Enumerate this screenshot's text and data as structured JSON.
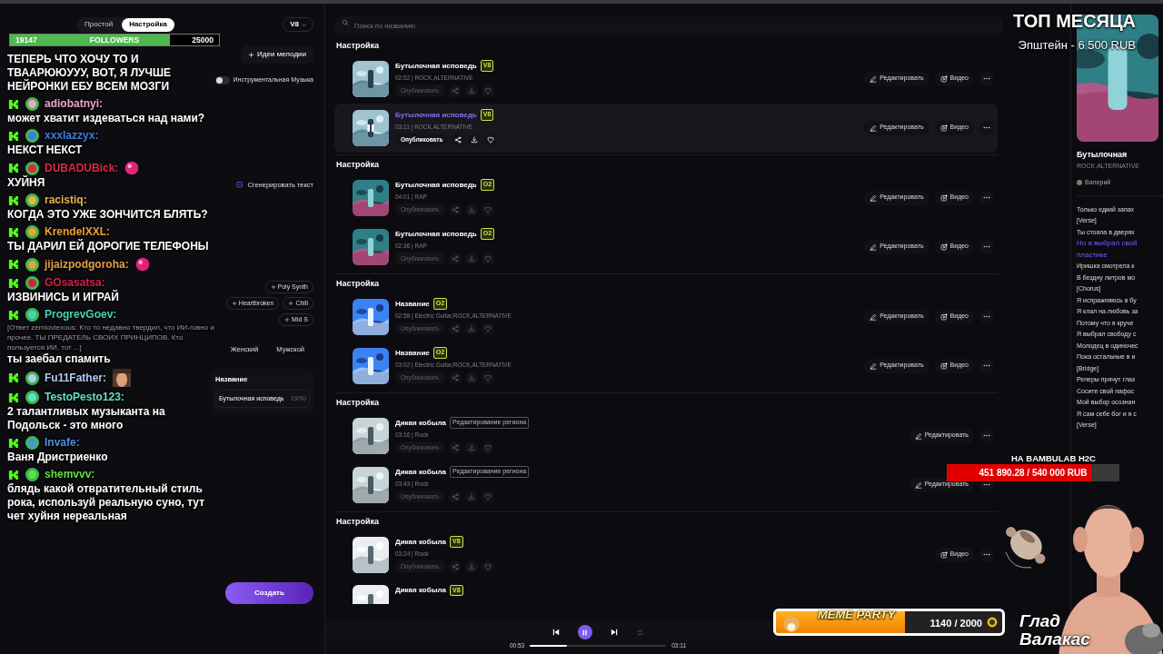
{
  "left_panel": {
    "tabs": [
      {
        "label": "Простой",
        "selected": false
      },
      {
        "label": "Настройка",
        "selected": true
      }
    ],
    "model": "V8",
    "melody_button": "Идеи мелодии",
    "instrumental": {
      "label": "Инструментальная Музыка",
      "on": false
    },
    "generate_lyrics": "Сгенерировать текст",
    "style_tags": [
      "Poly Synth",
      "Heartbroken",
      "Chill",
      "Mid S"
    ],
    "voice_options": [
      {
        "label": "Женский",
        "selected": false
      },
      {
        "label": "Мужской",
        "selected": false
      }
    ],
    "title_field": {
      "label": "Название",
      "value": "Бутылочная исповедь",
      "counter": "19/50"
    },
    "create_button": "Создать"
  },
  "search": {
    "placeholder": "Поиск по названию"
  },
  "groups": [
    {
      "heading": "Настройка",
      "tracks": [
        {
          "title": "Бутылочная исповедь",
          "badge": {
            "kind": "version",
            "label": "V8"
          },
          "meta": "02:52 | ROCK,ALTERNATIVE",
          "publish": "Опубликовать",
          "selected": false,
          "actions": [
            {
              "kind": "edit",
              "label": "Редактировать"
            },
            {
              "kind": "video",
              "label": "Видео"
            },
            {
              "kind": "more"
            }
          ]
        },
        {
          "title": "Бутылочная исповедь",
          "badge": {
            "kind": "version",
            "label": "V8"
          },
          "meta": "03:11 | ROCK,ALTERNATIVE",
          "publish": "Опубликовать",
          "selected": true,
          "actions": [
            {
              "kind": "edit",
              "label": "Редактировать"
            },
            {
              "kind": "video",
              "label": "Видео"
            },
            {
              "kind": "more"
            }
          ]
        }
      ]
    },
    {
      "heading": "Настройка",
      "tracks": [
        {
          "title": "Бутылочная исповедь",
          "badge": {
            "kind": "version",
            "label": "O2"
          },
          "meta": "04:01 | RAP",
          "publish": "Опубликовать",
          "selected": false,
          "actions": [
            {
              "kind": "edit",
              "label": "Редактировать"
            },
            {
              "kind": "video",
              "label": "Видео"
            },
            {
              "kind": "more"
            }
          ]
        },
        {
          "title": "Бутылочная исповедь",
          "badge": {
            "kind": "version",
            "label": "O2"
          },
          "meta": "02:36 | RAP",
          "publish": "Опубликовать",
          "selected": false,
          "actions": [
            {
              "kind": "edit",
              "label": "Редактировать"
            },
            {
              "kind": "video",
              "label": "Видео"
            },
            {
              "kind": "more"
            }
          ]
        }
      ]
    },
    {
      "heading": "Настройка",
      "tracks": [
        {
          "title": "Название",
          "badge": {
            "kind": "version",
            "label": "O2"
          },
          "meta": "02:58 | Electric Guitar,ROCK,ALTERNATIVE",
          "publish": "Опубликовать",
          "selected": false,
          "actions": [
            {
              "kind": "edit",
              "label": "Редактировать"
            },
            {
              "kind": "video",
              "label": "Видео"
            },
            {
              "kind": "more"
            }
          ]
        },
        {
          "title": "Название",
          "badge": {
            "kind": "version",
            "label": "O2"
          },
          "meta": "03:02 | Electric Guitar,ROCK,ALTERNATIVE",
          "publish": "Опубликовать",
          "selected": false,
          "actions": [
            {
              "kind": "edit",
              "label": "Редактировать"
            },
            {
              "kind": "video",
              "label": "Видео"
            },
            {
              "kind": "more"
            }
          ]
        }
      ]
    },
    {
      "heading": "Настройка",
      "tracks": [
        {
          "title": "Дикая кобыла",
          "badge": {
            "kind": "tag",
            "label": "Редактирование региона"
          },
          "meta": "03:16 | Rock",
          "publish": "Опубликовать",
          "selected": false,
          "actions": [
            {
              "kind": "edit",
              "label": "Редактировать"
            },
            {
              "kind": "more"
            }
          ]
        },
        {
          "title": "Дикая кобыла",
          "badge": {
            "kind": "tag",
            "label": "Редактирование региона"
          },
          "meta": "03:43 | Rock",
          "publish": "Опубликовать",
          "selected": false,
          "actions": [
            {
              "kind": "edit",
              "label": "Редактировать"
            },
            {
              "kind": "more"
            }
          ]
        }
      ]
    },
    {
      "heading": "Настройка",
      "tracks": [
        {
          "title": "Дикая кобыла",
          "badge": {
            "kind": "version",
            "label": "V8"
          },
          "meta": "03:24 | Rock",
          "publish": "Опубликовать",
          "selected": false,
          "actions": [
            {
              "kind": "video",
              "label": "Видео"
            },
            {
              "kind": "more"
            }
          ]
        },
        {
          "title": "Дикая кобыла",
          "badge": {
            "kind": "version",
            "label": "V8"
          },
          "selected": false
        }
      ]
    }
  ],
  "player": {
    "elapsed": "00:53",
    "total": "03:11",
    "level": 0.27,
    "playing": true
  },
  "now_playing": {
    "title": "Бутылочная",
    "genre": "ROCK,ALTERNATIVE",
    "author": "Валерий",
    "lyrics": [
      {
        "text": "Только едкий запах",
        "selected": false
      },
      {
        "text": "[Verse]",
        "selected": false
      },
      {
        "text": "Ты стояла в дверях",
        "selected": false
      },
      {
        "text": "Но я выбрал свой",
        "selected": true
      },
      {
        "text": "пластике",
        "selected": true
      },
      {
        "text": "Иришка смотрела к",
        "selected": false
      },
      {
        "text": "В бездну литров мо",
        "selected": false
      },
      {
        "text": "[Chorus]",
        "selected": false
      },
      {
        "text": "Я испражняюсь в бу",
        "selected": false
      },
      {
        "text": "Я клал на любовь за",
        "selected": false
      },
      {
        "text": "Потому что я круче",
        "selected": false
      },
      {
        "text": "Я выбрал свободу с",
        "selected": false
      },
      {
        "text": "Молодец в одиночес",
        "selected": false
      },
      {
        "text": "Пока остальные в и",
        "selected": false
      },
      {
        "text": "[Bridge]",
        "selected": false
      },
      {
        "text": "Реперы прячут глаз",
        "selected": false
      },
      {
        "text": "Сосите свой пафос",
        "selected": false
      },
      {
        "text": "Мой выбор осознан",
        "selected": false
      },
      {
        "text": "Я сам себе бог и я с",
        "selected": false
      },
      {
        "text": "[Verse]",
        "selected": false
      }
    ]
  },
  "stream_overlay": {
    "followers": {
      "current": "19147",
      "label": "FOLLOWERS",
      "goal": "25000",
      "level": 0.766
    },
    "chat": [
      {
        "kind": "continuation",
        "text": "ТЕПЕРЬ ЧТО ХОЧУ ТО И ТВААРЮЮУУУ, ВОТ, Я ЛУЧШЕ НЕЙРОНКИ ЕБУ ВСЕМ МОЗГИ"
      },
      {
        "kind": "message",
        "user": "adiobatnyi:",
        "color": "#f2a6c4",
        "text": "может хватит издеваться над нами?"
      },
      {
        "kind": "message",
        "user": "xxxlazzyx:",
        "color": "#3d7fe0",
        "text": "НЕКСТ НЕКСТ"
      },
      {
        "kind": "message",
        "user": "DUBADUBick:",
        "color": "#e0264a",
        "text": "ХУЙНЯ",
        "emote": true
      },
      {
        "kind": "message",
        "user": "racistiq:",
        "color": "#e8b44c",
        "text": "КОГДА ЭТО УЖЕ ЗОНЧИТСЯ БЛЯТЬ?"
      },
      {
        "kind": "message",
        "user": "KrendelXXL:",
        "color": "#f0a030",
        "text": "ТЫ ДАРИЛ ЕЙ ДОРОГИЕ ТЕЛЕФОНЫ"
      },
      {
        "kind": "message",
        "user": "jijaizpodgoroha:",
        "color": "#e8a040",
        "emote": true
      },
      {
        "kind": "message",
        "user": "GOsasatsa:",
        "color": "#d42045",
        "text": "ИЗВИНИСЬ И ИГРАЙ"
      },
      {
        "kind": "reply",
        "user": "ProgrevGoev:",
        "color": "#45d4b4",
        "quote": "[Ответ zemioviexous: Кто то недавно твердил, что ИИ-говно и прочее. ТЫ ПРЕДАТЕЛЬ СВОИХ ПРИНЦИПОВ. Кто пользуется ИИ, тот ...]",
        "text": "ты заебал спамить"
      },
      {
        "kind": "message",
        "user": "Fu11Father:",
        "color": "#b4cbf2",
        "picture": true
      },
      {
        "kind": "message",
        "user": "TestoPesto123:",
        "color": "#62e0c4",
        "text": "2 талантливых музыканта на Подольск - это много"
      },
      {
        "kind": "message",
        "user": "Invafe:",
        "color": "#4a92e2",
        "text": "Ваня Дристриенко"
      },
      {
        "kind": "message",
        "user": "shemvvv:",
        "color": "#62e040",
        "text": "блядь какой отвратительный стиль рока, используй реальную суно, тут чет хуйня нереальная"
      }
    ],
    "top_month": {
      "title": "ТОП МЕСЯЦА",
      "leader": "Эпштейн - 6 500 RUB"
    },
    "goal": {
      "title": "НА BAMBULAB H2C",
      "amount": "451 890.28 / 540 000 RUB",
      "level": 0.837
    },
    "meme_party": {
      "label": "MEME PARTY",
      "amount": "1140 / 2000",
      "level": 0.57
    },
    "streamer_name": "Глад Валакас"
  }
}
